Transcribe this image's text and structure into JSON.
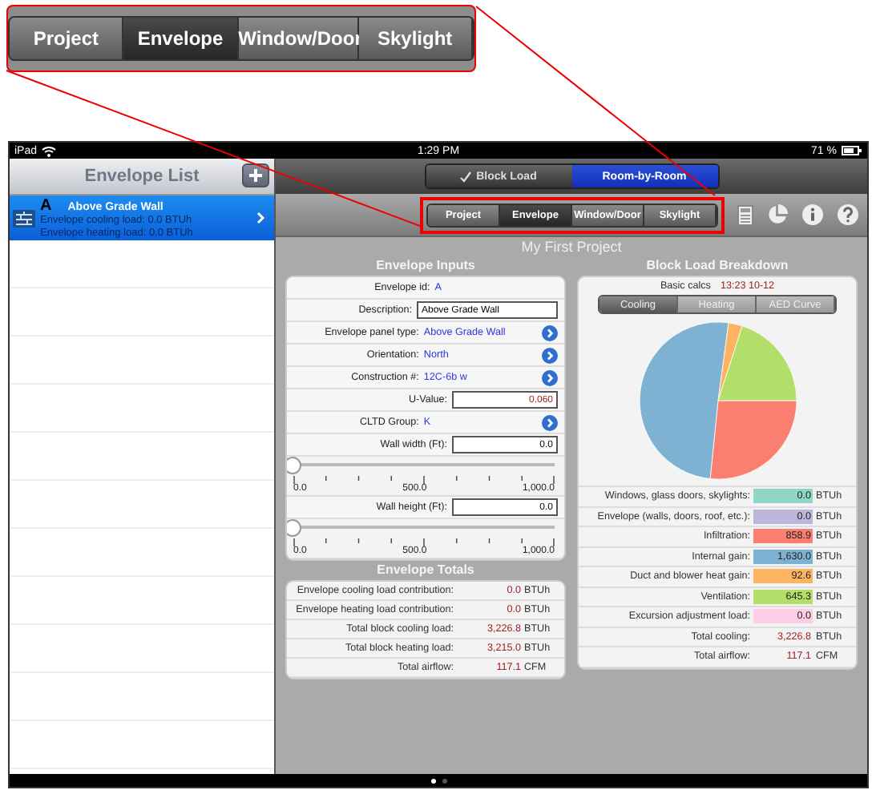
{
  "callout": {
    "tabs": [
      {
        "label": "Project",
        "selected": false
      },
      {
        "label": "Envelope",
        "selected": true
      },
      {
        "label": "Window/Door",
        "selected": false
      },
      {
        "label": "Skylight",
        "selected": false
      }
    ]
  },
  "status_bar": {
    "carrier": "iPad",
    "time": "1:29 PM",
    "battery": "71 %"
  },
  "sidebar": {
    "title": "Envelope List",
    "items": [
      {
        "letter": "A",
        "title": "Above Grade Wall",
        "lines": [
          "Envelope cooling load: 0.0 BTUh",
          "Envelope heating load: 0.0 BTUh"
        ],
        "selected": true
      }
    ]
  },
  "mode_switch": [
    {
      "label": "Block Load",
      "selected": true
    },
    {
      "label": "Room-by-Room",
      "selected": false
    }
  ],
  "tabs": [
    {
      "label": "Project",
      "selected": false
    },
    {
      "label": "Envelope",
      "selected": true
    },
    {
      "label": "Window/Door",
      "selected": false
    },
    {
      "label": "Skylight",
      "selected": false
    }
  ],
  "project_title": "My First Project",
  "inputs": {
    "title": "Envelope Inputs",
    "rows": [
      {
        "kind": "value",
        "label": "Envelope id:",
        "value": "A"
      },
      {
        "kind": "text",
        "label": "Description:",
        "value": "Above Grade Wall"
      },
      {
        "kind": "picker",
        "label": "Envelope panel type:",
        "value": "Above Grade Wall"
      },
      {
        "kind": "picker",
        "label": "Orientation:",
        "value": "North"
      },
      {
        "kind": "picker",
        "label": "Construction #:",
        "value": "12C-6b w"
      },
      {
        "kind": "number",
        "label": "U-Value:",
        "value": "0.060",
        "computed": true
      },
      {
        "kind": "picker",
        "label": "CLTD Group:",
        "value": "K"
      },
      {
        "kind": "number",
        "label": "Wall width (Ft):",
        "value": "0.0",
        "computed": false
      },
      {
        "kind": "slider",
        "level": 0,
        "ticks": [
          "0.0",
          "500.0",
          "1,000.0"
        ]
      },
      {
        "kind": "number",
        "label": "Wall height (Ft):",
        "value": "0.0",
        "computed": false
      },
      {
        "kind": "slider",
        "level": 0,
        "ticks": [
          "0.0",
          "500.0",
          "1,000.0"
        ]
      }
    ]
  },
  "totals": {
    "title": "Envelope Totals",
    "rows": [
      {
        "label": "Envelope cooling load contribution:",
        "value": "0.0",
        "unit": "BTUh"
      },
      {
        "label": "Envelope heating load contribution:",
        "value": "0.0",
        "unit": "BTUh"
      },
      {
        "label": "Total block cooling load:",
        "value": "3,226.8",
        "unit": "BTUh"
      },
      {
        "label": "Total block heating load:",
        "value": "3,215.0",
        "unit": "BTUh"
      },
      {
        "label": "Total airflow:",
        "value": "117.1",
        "unit": "CFM"
      }
    ]
  },
  "breakdown": {
    "title": "Block Load Breakdown",
    "basic_calcs": {
      "label": "Basic calcs",
      "value": "13:23 10-12"
    },
    "segments": [
      {
        "label": "Cooling",
        "selected": true
      },
      {
        "label": "Heating",
        "selected": false
      },
      {
        "label": "AED Curve",
        "selected": false
      }
    ],
    "chart_data": {
      "type": "pie",
      "values": [
        0,
        0,
        26.62,
        50.51,
        2.87,
        20.0,
        0
      ]
    },
    "loads": [
      {
        "label": "Windows, glass doors, skylights:",
        "value": "0.0",
        "unit": "BTUh",
        "color": "#8fd6c6"
      },
      {
        "label": "Envelope (walls, doors, roof, etc.):",
        "value": "0.0",
        "unit": "BTUh",
        "color": "#bdb6da"
      },
      {
        "label": "Infiltration:",
        "value": "858.9",
        "unit": "BTUh",
        "color": "#fa7f70"
      },
      {
        "label": "Internal gain:",
        "value": "1,630.0",
        "unit": "BTUh",
        "color": "#7fb1d3"
      },
      {
        "label": "Duct and blower heat gain:",
        "value": "92.6",
        "unit": "BTUh",
        "color": "#fdb462"
      },
      {
        "label": "Ventilation:",
        "value": "645.3",
        "unit": "BTUh",
        "color": "#b3de69"
      },
      {
        "label": "Excursion adjustment load:",
        "value": "0.0",
        "unit": "BTUh",
        "color": "#fccde5"
      }
    ],
    "totals": [
      {
        "label": "Total cooling:",
        "value": "3,226.8",
        "unit": "BTUh"
      },
      {
        "label": "Total airflow:",
        "value": "117.1",
        "unit": "CFM"
      }
    ]
  },
  "page_indicator": [
    {
      "selected": true
    },
    {
      "selected": false
    }
  ]
}
